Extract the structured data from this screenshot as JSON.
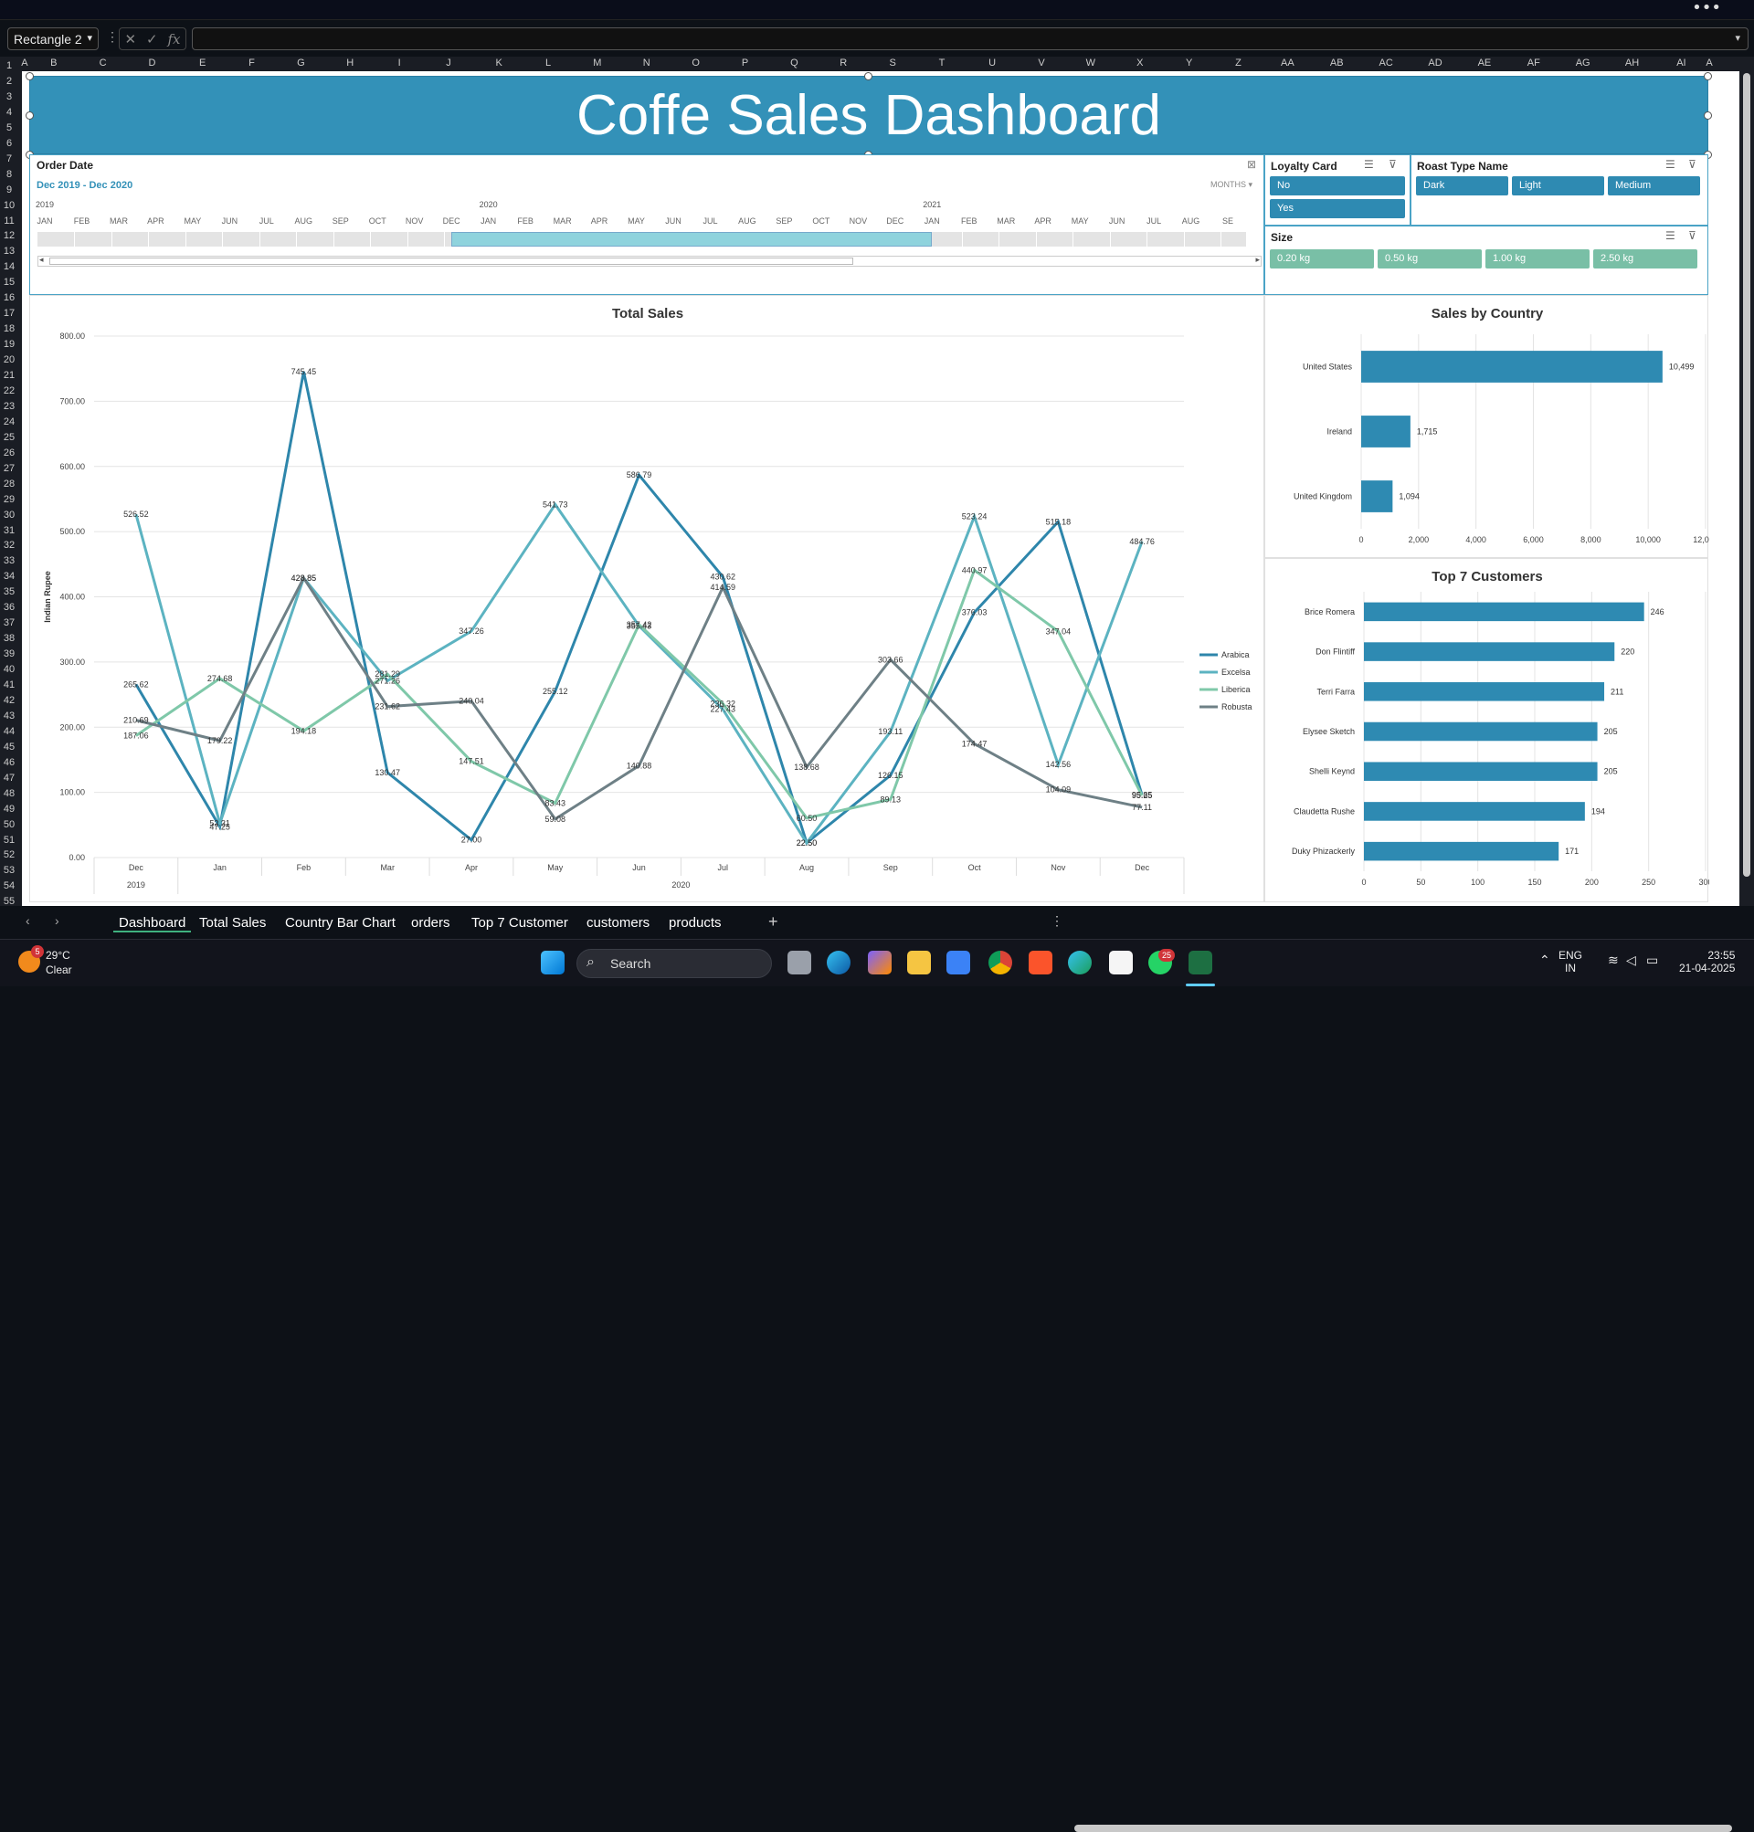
{
  "window": {
    "more_icon": "more-horizontal-icon"
  },
  "formula_bar": {
    "name_box": "Rectangle 2",
    "fx_label": "fx",
    "formula": ""
  },
  "columns": [
    "A",
    "B",
    "C",
    "D",
    "E",
    "F",
    "G",
    "H",
    "I",
    "J",
    "K",
    "L",
    "M",
    "N",
    "O",
    "P",
    "Q",
    "R",
    "S",
    "T",
    "U",
    "V",
    "W",
    "X",
    "Y",
    "Z",
    "AA",
    "AB",
    "AC",
    "AD",
    "AE",
    "AF",
    "AG",
    "AH",
    "AI",
    "A"
  ],
  "rows": [
    "1",
    "2",
    "3",
    "4",
    "5",
    "6",
    "7",
    "8",
    "9",
    "10",
    "11",
    "12",
    "13",
    "14",
    "15",
    "16",
    "17",
    "18",
    "19",
    "20",
    "21",
    "22",
    "23",
    "24",
    "25",
    "26",
    "27",
    "28",
    "29",
    "30",
    "31",
    "32",
    "33",
    "34",
    "35",
    "36",
    "37",
    "38",
    "39",
    "40",
    "41",
    "42",
    "43",
    "44",
    "45",
    "46",
    "47",
    "48",
    "49",
    "50",
    "51",
    "52",
    "53",
    "54",
    "55"
  ],
  "dashboard": {
    "title": "Coffe Sales Dashboard"
  },
  "timeline": {
    "title": "Order Date",
    "range": "Dec 2019 - Dec 2020",
    "period_selector": "MONTHS",
    "years": [
      "2019",
      "2020",
      "2021"
    ],
    "months": [
      "JAN",
      "FEB",
      "MAR",
      "APR",
      "MAY",
      "JUN",
      "JUL",
      "AUG",
      "SEP",
      "OCT",
      "NOV",
      "DEC",
      "JAN",
      "FEB",
      "MAR",
      "APR",
      "MAY",
      "JUN",
      "JUL",
      "AUG",
      "SEP",
      "OCT",
      "NOV",
      "DEC",
      "JAN",
      "FEB",
      "MAR",
      "APR",
      "MAY",
      "JUN",
      "JUL",
      "AUG",
      "SE"
    ]
  },
  "slicers": {
    "loyalty": {
      "title": "Loyalty Card",
      "items": [
        "No",
        "Yes"
      ]
    },
    "roast": {
      "title": "Roast Type Name",
      "items": [
        "Dark",
        "Light",
        "Medium"
      ]
    },
    "size": {
      "title": "Size",
      "items": [
        "0.20 kg",
        "0.50 kg",
        "1.00 kg",
        "2.50 kg"
      ]
    }
  },
  "chart_data": [
    {
      "type": "line",
      "title": "Total Sales",
      "ylabel": "Indian Rupee",
      "ylim": [
        0,
        800
      ],
      "yticks": [
        "0.00",
        "100.00",
        "200.00",
        "300.00",
        "400.00",
        "500.00",
        "600.00",
        "700.00",
        "800.00"
      ],
      "categories": [
        "Dec",
        "Jan",
        "Feb",
        "Mar",
        "Apr",
        "May",
        "Jun",
        "Jul",
        "Aug",
        "Sep",
        "Oct",
        "Nov",
        "Dec"
      ],
      "category_groups": [
        "2019",
        "2020"
      ],
      "series": [
        {
          "name": "Arabica",
          "color": "#2e86ab",
          "values": [
            265.62,
            47.25,
            745.45,
            130.47,
            27.0,
            255.12,
            586.79,
            430.62,
            22.5,
            126.15,
            376.03,
            515.18,
            95.85
          ]
        },
        {
          "name": "Excelsa",
          "color": "#5cb3c1",
          "values": [
            526.52,
            52.31,
            428.85,
            271.26,
            347.26,
            541.73,
            355.43,
            227.43,
            22.5,
            193.11,
            523.24,
            142.56,
            484.76
          ]
        },
        {
          "name": "Liberica",
          "color": "#7fc8a9",
          "values": [
            187.06,
            274.68,
            194.18,
            281.29,
            147.51,
            83.43,
            357.42,
            236.32,
            60.5,
            89.13,
            440.97,
            347.04,
            95.25
          ]
        },
        {
          "name": "Robusta",
          "color": "#6e8086",
          "values": [
            210.69,
            179.22,
            428.85,
            231.62,
            240.04,
            59.08,
            140.88,
            414.59,
            138.68,
            303.66,
            174.47,
            104.09,
            77.11
          ]
        }
      ],
      "legend_position": "right",
      "grid": true
    },
    {
      "type": "bar",
      "orientation": "horizontal",
      "title": "Sales by Country",
      "categories": [
        "United States",
        "Ireland",
        "United Kingdom"
      ],
      "values": [
        10499,
        1715,
        1094
      ],
      "value_labels": [
        "10,499",
        "1,715",
        "1,094"
      ],
      "xlim": [
        0,
        12000
      ],
      "xticks": [
        "0",
        "2,000",
        "4,000",
        "6,000",
        "8,000",
        "10,000",
        "12,000"
      ],
      "color": "#2e8ab2",
      "grid": true
    },
    {
      "type": "bar",
      "orientation": "horizontal",
      "title": "Top 7 Customers",
      "categories": [
        "Brice Romera",
        "Don Flintiff",
        "Terri Farra",
        "Elysee Sketch",
        "Shelli Keynd",
        "Claudetta Rushe",
        "Duky Phizackerly"
      ],
      "values": [
        246,
        220,
        211,
        205,
        205,
        194,
        171
      ],
      "xlim": [
        0,
        300
      ],
      "xticks": [
        "0",
        "50",
        "100",
        "150",
        "200",
        "250",
        "300"
      ],
      "color": "#2e8ab2",
      "grid": true
    }
  ],
  "sheet_tabs": [
    "Dashboard",
    "Total Sales",
    "Country Bar Chart",
    "orders",
    "Top 7 Customer",
    "customers",
    "products"
  ],
  "active_tab": "Dashboard",
  "taskbar": {
    "weather_temp": "29°C",
    "weather_desc": "Clear",
    "weather_badge": "5",
    "search_placeholder": "Search",
    "whatsapp_badge": "25",
    "lang_line1": "ENG",
    "lang_line2": "IN",
    "time": "23:55",
    "date": "21-04-2025"
  }
}
